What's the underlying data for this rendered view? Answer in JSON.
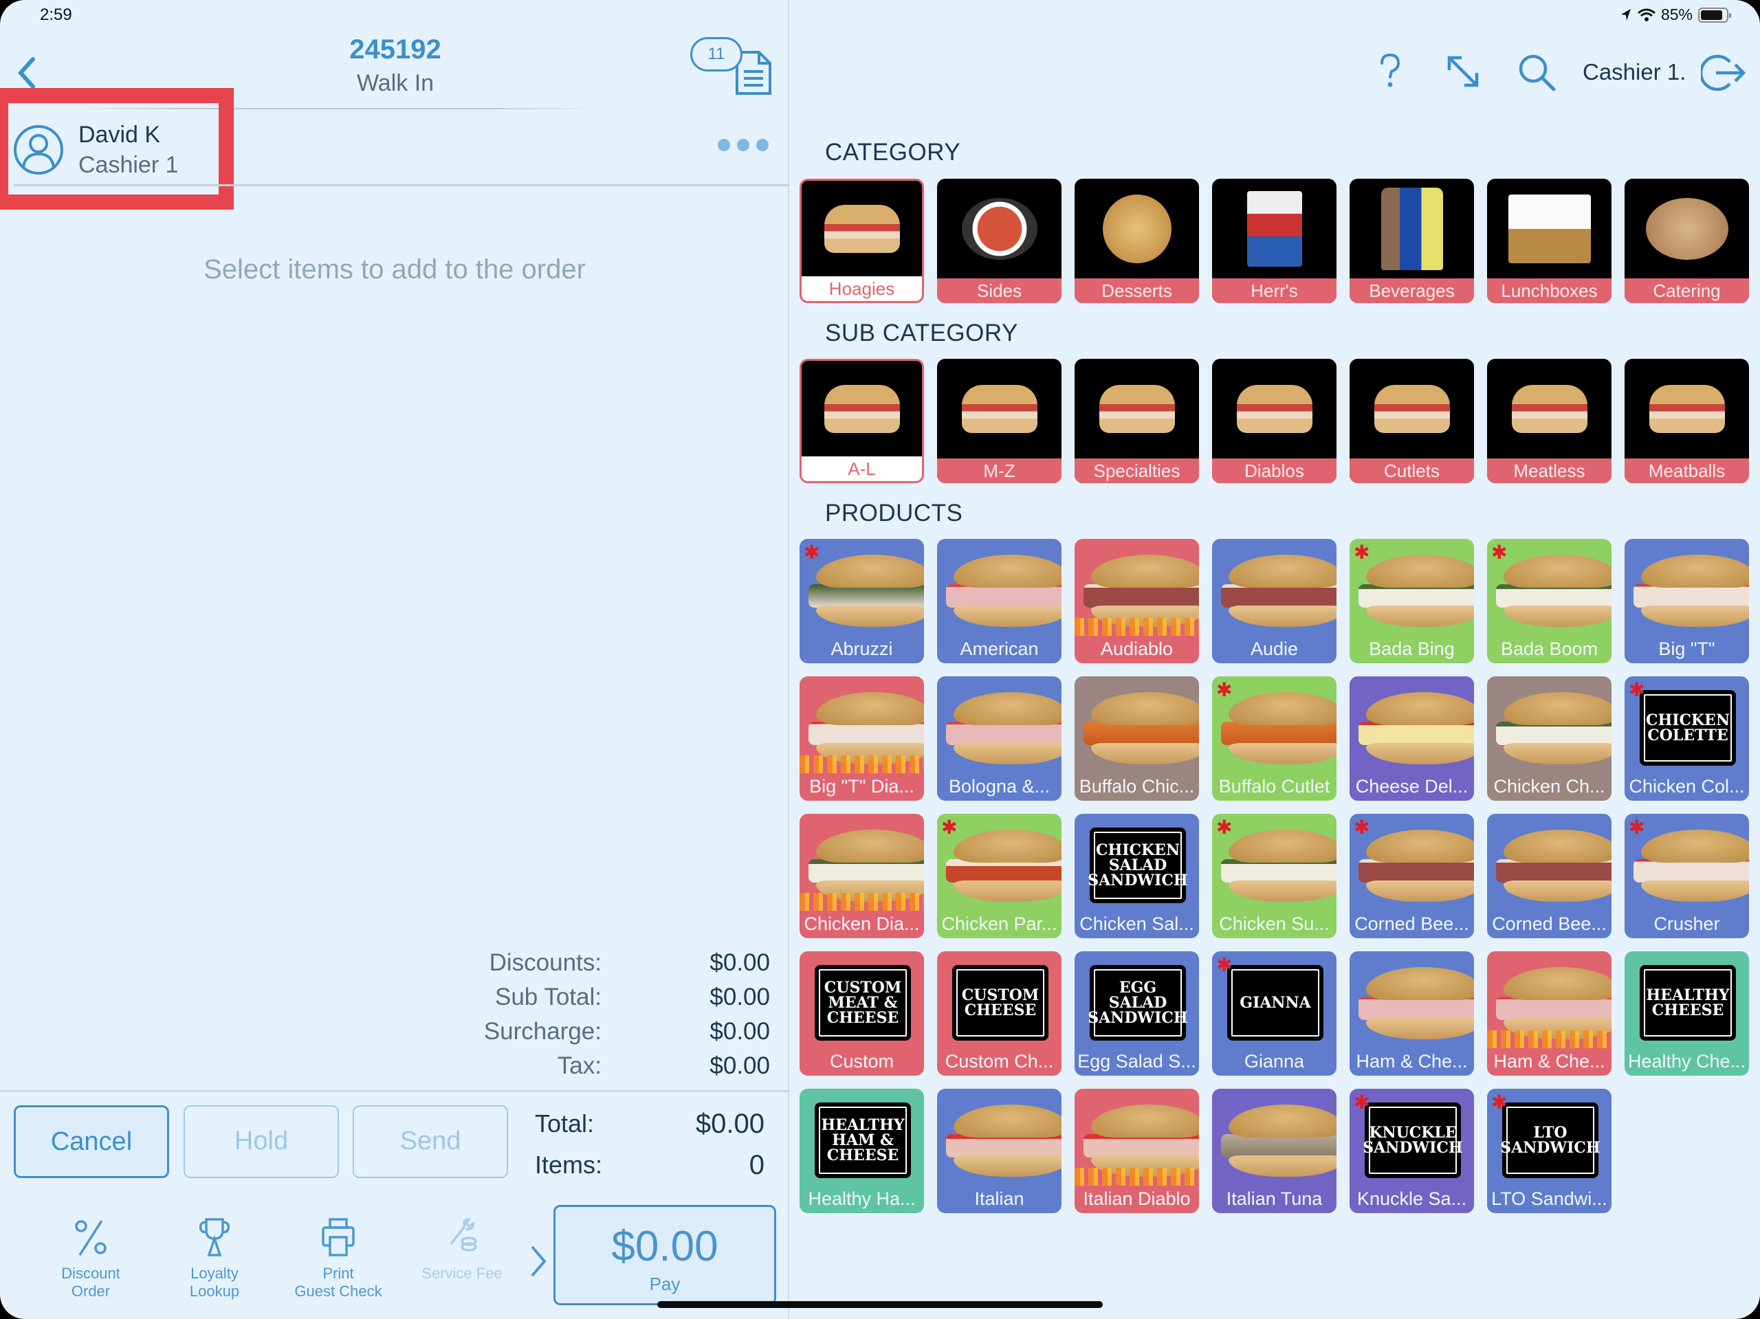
{
  "status_bar": {
    "time": "2:59",
    "battery": "85%",
    "battery_level": 0.85
  },
  "order": {
    "number": "245192",
    "type": "Walk In",
    "open_orders_count": "11"
  },
  "customer": {
    "name": "David K",
    "role": "Cashier 1"
  },
  "order_panel": {
    "empty_message": "Select items to add to the order"
  },
  "summary": [
    {
      "label": "Discounts:",
      "value": "$0.00"
    },
    {
      "label": "Sub Total:",
      "value": "$0.00"
    },
    {
      "label": "Surcharge:",
      "value": "$0.00"
    },
    {
      "label": "Tax:",
      "value": "$0.00"
    }
  ],
  "grand": {
    "total_label": "Total:",
    "total_value": "$0.00",
    "items_label": "Items:",
    "items_value": "0"
  },
  "buttons": {
    "cancel": "Cancel",
    "hold": "Hold",
    "send": "Send"
  },
  "actions": [
    {
      "icon": "percent-icon",
      "line1": "Discount",
      "line2": "Order",
      "enabled": true
    },
    {
      "icon": "trophy-icon",
      "line1": "Loyalty",
      "line2": "Lookup",
      "enabled": true
    },
    {
      "icon": "printer-icon",
      "line1": "Print",
      "line2": "Guest Check",
      "enabled": true
    },
    {
      "icon": "wrench-coins-icon",
      "line1": "",
      "line2": "Service Fee",
      "enabled": false
    }
  ],
  "pay": {
    "amount": "$0.00",
    "label": "Pay"
  },
  "header_right": {
    "cashier_label": "Cashier 1."
  },
  "colors": {
    "accent": "#3b8fca",
    "background": "#e5f2fb",
    "highlight_box": "#e8444d",
    "category_label": "#e0646f",
    "tile_blue": "#5f7dcc",
    "tile_red": "#e0646f",
    "tile_green": "#8ed062",
    "tile_brown": "#9a8580",
    "tile_purple": "#7264c4",
    "tile_teal": "#5ec4a4"
  },
  "sections": {
    "category": "CATEGORY",
    "sub_category": "SUB CATEGORY",
    "products": "PRODUCTS"
  },
  "categories": [
    {
      "label": "Hoagies",
      "selected": true
    },
    {
      "label": "Sides",
      "selected": false
    },
    {
      "label": "Desserts",
      "selected": false
    },
    {
      "label": "Herr's",
      "selected": false
    },
    {
      "label": "Beverages",
      "selected": false
    },
    {
      "label": "Lunchboxes",
      "selected": false
    },
    {
      "label": "Catering",
      "selected": false
    }
  ],
  "sub_categories": [
    {
      "label": "A-L",
      "selected": true
    },
    {
      "label": "M-Z",
      "selected": false
    },
    {
      "label": "Specialties",
      "selected": false
    },
    {
      "label": "Diablos",
      "selected": false
    },
    {
      "label": "Cutlets",
      "selected": false
    },
    {
      "label": "Meatless",
      "selected": false
    },
    {
      "label": "Meatballs",
      "selected": false
    }
  ],
  "products": [
    {
      "label": "Abruzzi",
      "color": "blue",
      "star": true,
      "art": "sandwich",
      "filling": "greens"
    },
    {
      "label": "American",
      "color": "blue",
      "star": false,
      "art": "sandwich",
      "filling": "ham"
    },
    {
      "label": "Audiablo",
      "color": "red",
      "star": false,
      "art": "sandwich",
      "filling": "beef",
      "flames": true
    },
    {
      "label": "Audie",
      "color": "blue",
      "star": false,
      "art": "sandwich",
      "filling": "beef"
    },
    {
      "label": "Bada Bing",
      "color": "green",
      "star": true,
      "art": "sandwich",
      "filling": "chicken"
    },
    {
      "label": "Bada Boom",
      "color": "green",
      "star": true,
      "art": "sandwich",
      "filling": "chicken"
    },
    {
      "label": "Big \"T\"",
      "color": "blue",
      "star": false,
      "art": "sandwich",
      "filling": "turkey"
    },
    {
      "label": "Big \"T\" Dia...",
      "color": "red",
      "star": false,
      "art": "sandwich",
      "filling": "turkey",
      "flames": true
    },
    {
      "label": "Bologna &...",
      "color": "blue",
      "star": false,
      "art": "sandwich",
      "filling": "ham"
    },
    {
      "label": "Buffalo Chic...",
      "color": "brown",
      "star": false,
      "art": "sandwich",
      "filling": "buffalo"
    },
    {
      "label": "Buffalo Cutlet",
      "color": "green",
      "star": true,
      "art": "sandwich",
      "filling": "buffalo"
    },
    {
      "label": "Cheese Del...",
      "color": "purple",
      "star": false,
      "art": "sandwich",
      "filling": "cheese"
    },
    {
      "label": "Chicken Ch...",
      "color": "brown",
      "star": false,
      "art": "sandwich",
      "filling": "chicken"
    },
    {
      "label": "Chicken Col...",
      "color": "blue",
      "star": true,
      "art": "sign",
      "sign": "CHICKEN\nCOLETTE"
    },
    {
      "label": "Chicken Dia...",
      "color": "red",
      "star": false,
      "art": "sandwich",
      "filling": "chicken",
      "flames": true
    },
    {
      "label": "Chicken Par...",
      "color": "green",
      "star": true,
      "art": "sandwich",
      "filling": "parm"
    },
    {
      "label": "Chicken Sal...",
      "color": "blue",
      "star": false,
      "art": "sign",
      "sign": "CHICKEN\nSALAD\nSANDWICH"
    },
    {
      "label": "Chicken Su...",
      "color": "green",
      "star": true,
      "art": "sandwich",
      "filling": "chicken"
    },
    {
      "label": "Corned Bee...",
      "color": "blue",
      "star": true,
      "art": "sandwich",
      "filling": "beef"
    },
    {
      "label": "Corned Bee...",
      "color": "blue",
      "star": false,
      "art": "sandwich",
      "filling": "beef"
    },
    {
      "label": "Crusher",
      "color": "blue",
      "star": true,
      "art": "sandwich",
      "filling": "turkey"
    },
    {
      "label": "Custom",
      "color": "red",
      "star": false,
      "art": "sign",
      "sign": "CUSTOM\nMEAT &\nCHEESE"
    },
    {
      "label": "Custom Ch...",
      "color": "red",
      "star": false,
      "art": "sign",
      "sign": "CUSTOM\nCHEESE"
    },
    {
      "label": "Egg Salad S...",
      "color": "blue",
      "star": false,
      "art": "sign",
      "sign": "EGG SALAD\nSANDWICH"
    },
    {
      "label": "Gianna",
      "color": "blue",
      "star": true,
      "art": "sign",
      "sign": "GIANNA"
    },
    {
      "label": "Ham & Che...",
      "color": "blue",
      "star": false,
      "art": "sandwich",
      "filling": "ham"
    },
    {
      "label": "Ham & Che...",
      "color": "red",
      "star": false,
      "art": "sandwich",
      "filling": "ham",
      "flames": true
    },
    {
      "label": "Healthy Che...",
      "color": "teal",
      "star": false,
      "art": "sign",
      "sign": "HEALTHY\nCHEESE"
    },
    {
      "label": "Healthy Ha...",
      "color": "teal",
      "star": false,
      "art": "sign",
      "sign": "HEALTHY\nHAM &\nCHEESE"
    },
    {
      "label": "Italian",
      "color": "blue",
      "star": false,
      "art": "sandwich",
      "filling": "italian"
    },
    {
      "label": "Italian Diablo",
      "color": "red",
      "star": false,
      "art": "sandwich",
      "filling": "italian",
      "flames": true
    },
    {
      "label": "Italian Tuna",
      "color": "purple",
      "star": false,
      "art": "sandwich",
      "filling": "tuna"
    },
    {
      "label": "Knuckle Sa...",
      "color": "purple",
      "star": true,
      "art": "sign",
      "sign": "KNUCKLE\nSANDWICH"
    },
    {
      "label": "LTO Sandwi...",
      "color": "blue",
      "star": true,
      "art": "sign",
      "sign": "LTO\nSANDWICH"
    }
  ]
}
